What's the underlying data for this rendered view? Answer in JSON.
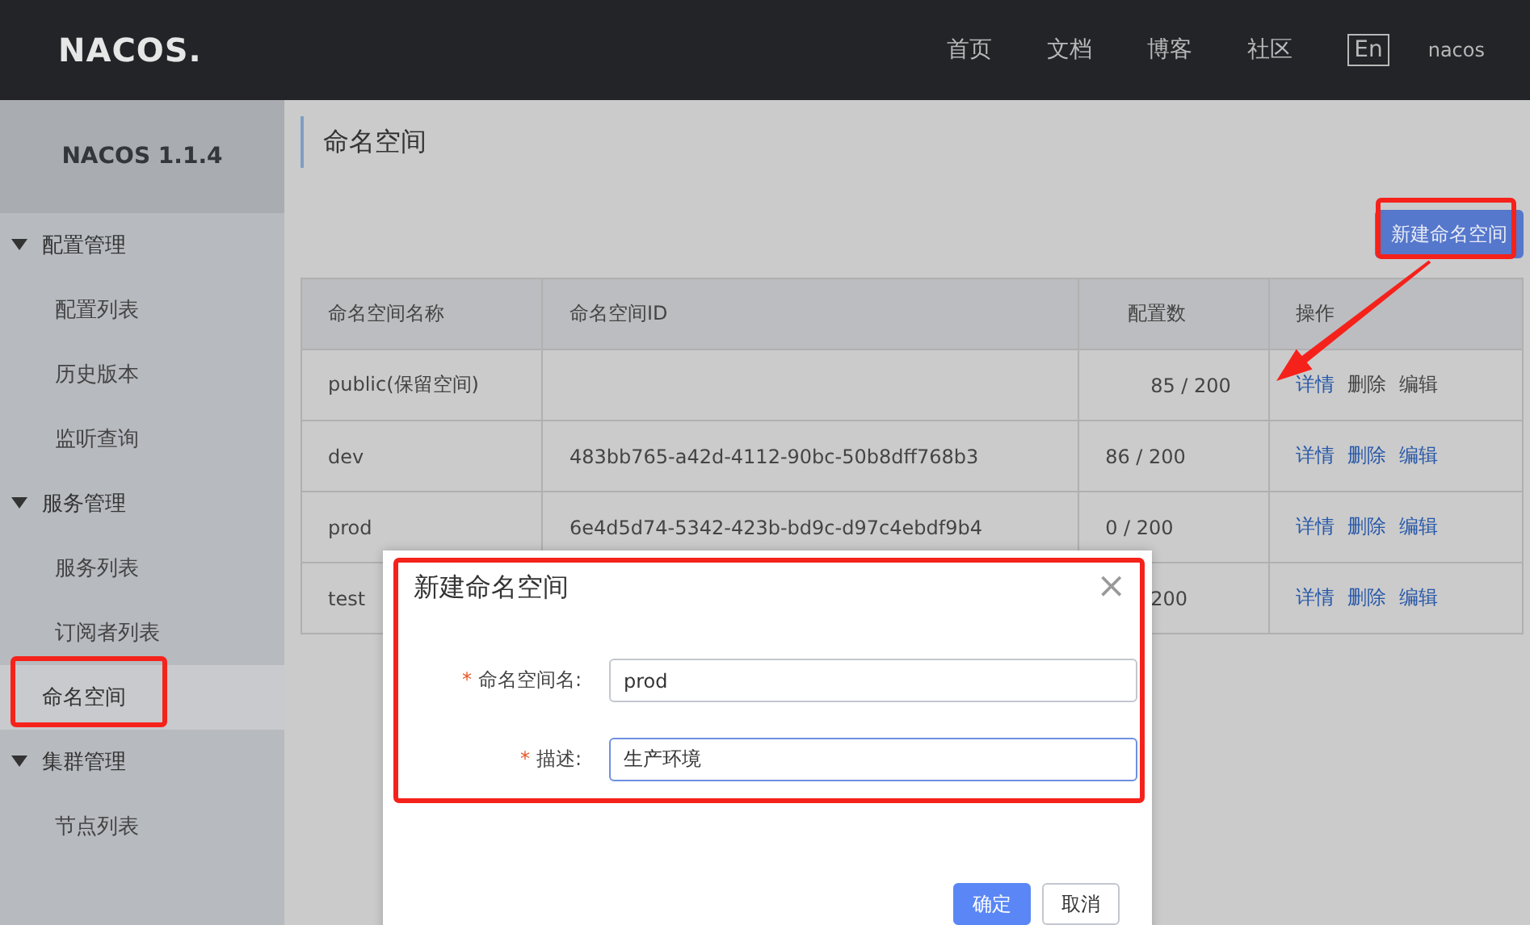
{
  "header": {
    "logo": "NACOS.",
    "nav": [
      "首页",
      "文档",
      "博客",
      "社区"
    ],
    "lang": "En",
    "user": "nacos"
  },
  "sidebar": {
    "version": "NACOS 1.1.4",
    "items": [
      {
        "kind": "group",
        "label": "配置管理",
        "expanded": true,
        "children": [
          {
            "label": "配置列表",
            "selected": false
          },
          {
            "label": "历史版本",
            "selected": false
          },
          {
            "label": "监听查询",
            "selected": false
          }
        ]
      },
      {
        "kind": "group",
        "label": "服务管理",
        "expanded": true,
        "children": [
          {
            "label": "服务列表",
            "selected": false
          },
          {
            "label": "订阅者列表",
            "selected": false
          }
        ]
      },
      {
        "kind": "link",
        "label": "命名空间",
        "selected": true
      },
      {
        "kind": "group",
        "label": "集群管理",
        "expanded": true,
        "children": [
          {
            "label": "节点列表",
            "selected": false
          }
        ]
      }
    ]
  },
  "page": {
    "title": "命名空间",
    "create_button": "新建命名空间"
  },
  "table": {
    "columns": [
      "命名空间名称",
      "命名空间ID",
      "配置数",
      "操作"
    ],
    "rows": [
      {
        "name": "public(保留空间)",
        "config": "85 / 200",
        "actions": [
          "详情",
          "删除",
          "编辑"
        ],
        "disabled_actions": [
          false,
          true,
          true
        ]
      },
      {
        "name": "dev",
        "id": "483bb765-a42d-4112-90bc-50b8dff768b3",
        "config": "86 / 200",
        "actions": [
          "详情",
          "删除",
          "编辑"
        ],
        "disabled_actions": [
          false,
          false,
          false
        ]
      },
      {
        "name": "prod",
        "id": "6e4d5d74-5342-423b-bd9c-d97c4ebdf9b4",
        "config": "0 / 200",
        "actions": [
          "详情",
          "删除",
          "编辑"
        ],
        "disabled_actions": [
          false,
          false,
          false
        ]
      },
      {
        "name": "test",
        "config": "200",
        "actions": [
          "详情",
          "删除",
          "编辑"
        ],
        "disabled_actions": [
          false,
          false,
          false
        ]
      }
    ]
  },
  "dialog": {
    "title": "新建命名空间",
    "close": "×",
    "required_mark": "*",
    "fields": [
      {
        "label": "命名空间名:",
        "required": true,
        "value": "prod",
        "focused": false
      },
      {
        "label": "描述:",
        "required": true,
        "value": "生产环境",
        "focused": true
      }
    ],
    "buttons": [
      {
        "label": "确定",
        "kind": "primary"
      },
      {
        "label": "取消",
        "kind": "default"
      }
    ]
  }
}
